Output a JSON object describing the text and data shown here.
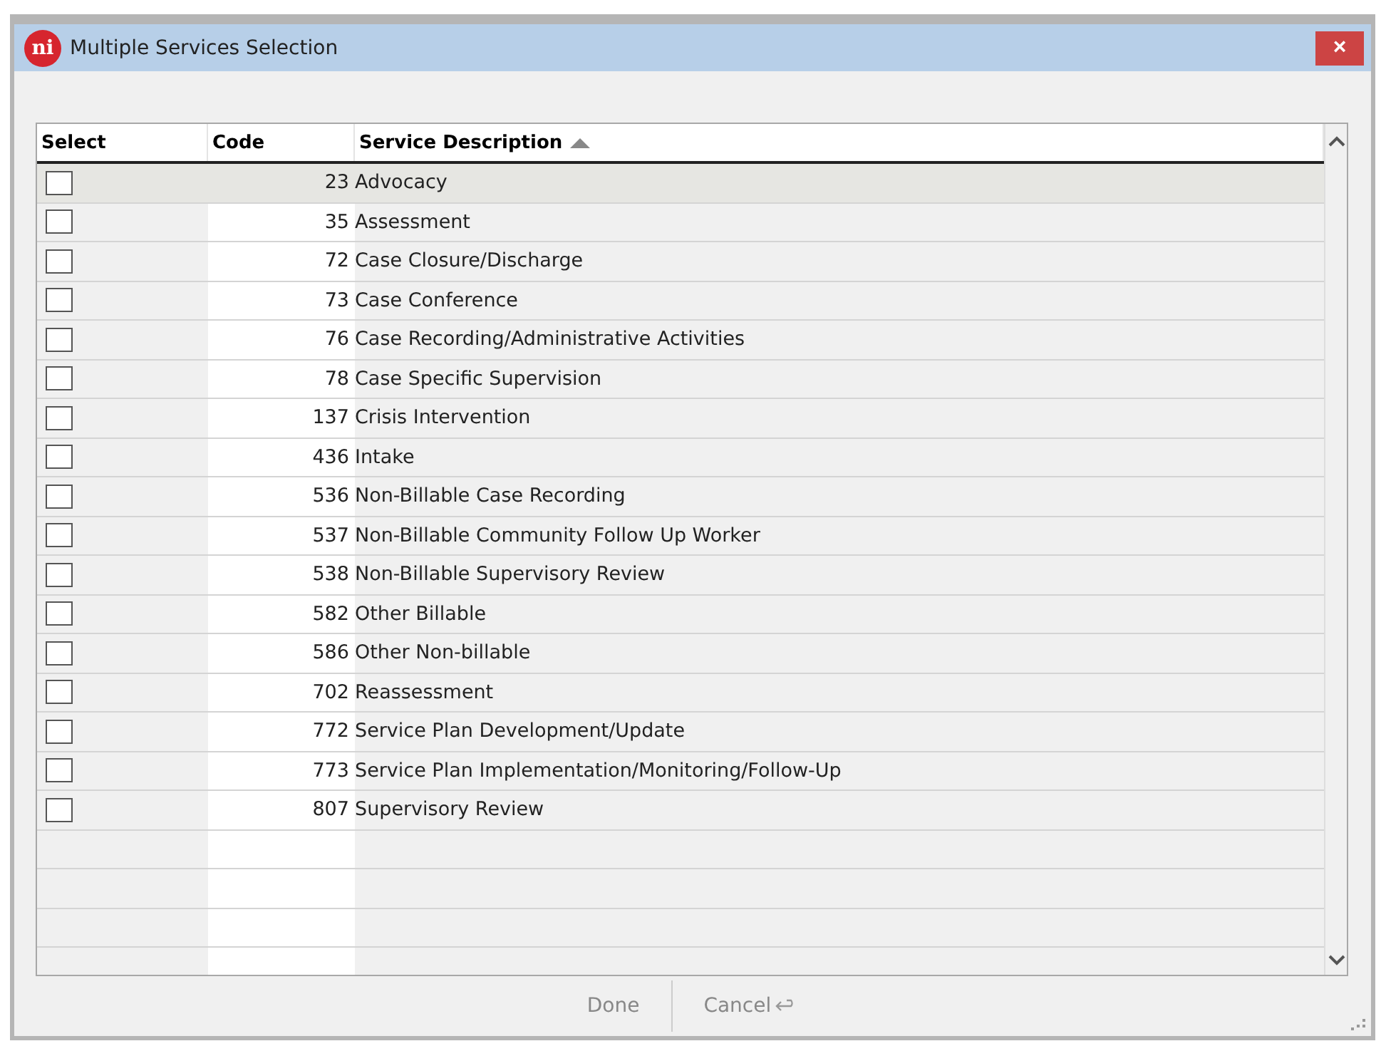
{
  "window": {
    "logo": "ni",
    "title": "Multiple Services Selection",
    "close": "×"
  },
  "table": {
    "columns": [
      {
        "label": "Select",
        "sorted": false
      },
      {
        "label": "Code",
        "sorted": false
      },
      {
        "label": "Service Description",
        "sorted": true
      }
    ],
    "rows": [
      {
        "checked": false,
        "selected": true,
        "code": "23",
        "description": "Advocacy"
      },
      {
        "checked": false,
        "selected": false,
        "code": "35",
        "description": "Assessment"
      },
      {
        "checked": false,
        "selected": false,
        "code": "72",
        "description": "Case Closure/Discharge"
      },
      {
        "checked": false,
        "selected": false,
        "code": "73",
        "description": "Case Conference"
      },
      {
        "checked": false,
        "selected": false,
        "code": "76",
        "description": "Case Recording/Administrative Activities"
      },
      {
        "checked": false,
        "selected": false,
        "code": "78",
        "description": "Case Specific Supervision"
      },
      {
        "checked": false,
        "selected": false,
        "code": "137",
        "description": "Crisis Intervention"
      },
      {
        "checked": false,
        "selected": false,
        "code": "436",
        "description": "Intake"
      },
      {
        "checked": false,
        "selected": false,
        "code": "536",
        "description": "Non-Billable Case Recording"
      },
      {
        "checked": false,
        "selected": false,
        "code": "537",
        "description": "Non-Billable Community Follow Up Worker"
      },
      {
        "checked": false,
        "selected": false,
        "code": "538",
        "description": "Non-Billable Supervisory Review"
      },
      {
        "checked": false,
        "selected": false,
        "code": "582",
        "description": "Other Billable"
      },
      {
        "checked": false,
        "selected": false,
        "code": "586",
        "description": "Other Non-billable"
      },
      {
        "checked": false,
        "selected": false,
        "code": "702",
        "description": "Reassessment"
      },
      {
        "checked": false,
        "selected": false,
        "code": "772",
        "description": "Service Plan Development/Update"
      },
      {
        "checked": false,
        "selected": false,
        "code": "773",
        "description": "Service Plan Implementation/Monitoring/Follow-Up"
      },
      {
        "checked": false,
        "selected": false,
        "code": "807",
        "description": "Supervisory Review"
      }
    ]
  },
  "buttons": [
    {
      "label": "Done",
      "kind": "done"
    },
    {
      "label": "Cancel",
      "kind": "cancel"
    }
  ]
}
